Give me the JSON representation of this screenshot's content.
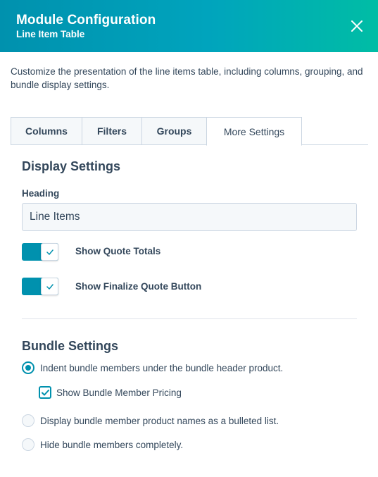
{
  "header": {
    "title": "Module Configuration",
    "subtitle": "Line Item Table",
    "background_color": "#00a4bd"
  },
  "description": "Customize the presentation of the line items table, including columns, grouping, and bundle display settings.",
  "tabs": [
    {
      "label": "Columns",
      "active": false
    },
    {
      "label": "Filters",
      "active": false
    },
    {
      "label": "Groups",
      "active": false
    },
    {
      "label": "More Settings",
      "active": true
    }
  ],
  "display_settings": {
    "title": "Display Settings",
    "heading_label": "Heading",
    "heading_value": "Line Items",
    "toggles": [
      {
        "label": "Show Quote Totals",
        "on": true
      },
      {
        "label": "Show Finalize Quote Button",
        "on": true
      }
    ]
  },
  "bundle_settings": {
    "title": "Bundle Settings",
    "options": [
      {
        "label": "Indent bundle members under the bundle header product.",
        "selected": true
      },
      {
        "label": "Display bundle member product names as a bulleted list.",
        "selected": false
      },
      {
        "label": "Hide bundle members completely.",
        "selected": false
      }
    ],
    "pricing_checkbox": {
      "label": "Show Bundle Member Pricing",
      "checked": true
    }
  },
  "colors": {
    "accent": "#0091ae",
    "text": "#33475b",
    "border": "#cbd6e2",
    "input_bg": "#f5f8fa"
  },
  "icons": {
    "close": "close-icon",
    "check": "checkmark-icon"
  }
}
